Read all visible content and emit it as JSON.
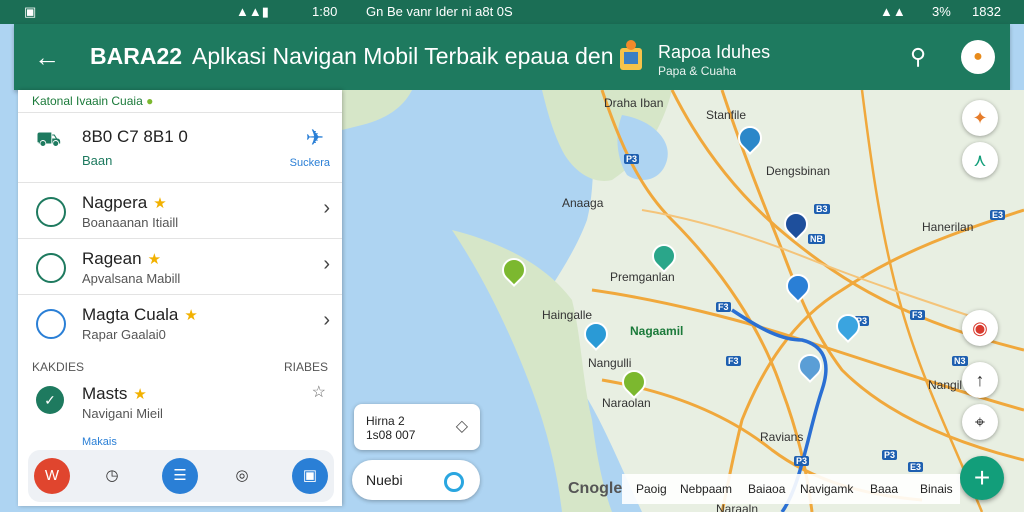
{
  "status": {
    "left_time": "1:80",
    "center_text": "Gn Be vanr Ider ni a8t 0S",
    "right_battery": "3%",
    "right_time": "1832"
  },
  "appbar": {
    "back_label": "←",
    "app_name": "BARA22",
    "title": "Aplkasi Navigan Mobil Terbaik epaua den",
    "weather_title": "Rapoa Iduhes",
    "weather_sub": "Papa & Cuaha",
    "search_label": "⚲",
    "avatar_label": "●"
  },
  "panel": {
    "header": "Katonal Ivaain Cuaia",
    "top": {
      "title": "8B0 C7 8B1 0",
      "sub": "Baan",
      "action": "Suckera"
    },
    "items": [
      {
        "title": "Nagpera",
        "sub": "Boanaanan Itiaill"
      },
      {
        "title": "Ragean",
        "sub": "Apvalsana Mabill"
      },
      {
        "title": "Magta Cuala",
        "sub": "Rapar Gaalai0"
      }
    ],
    "section_left": "KAKDIES",
    "section_right": "RIABES",
    "fav": {
      "title": "Masts",
      "sub": "Navigani Mieil"
    },
    "footer_label": "Makais"
  },
  "bottombar": {
    "b1": "W",
    "b2": "◷",
    "b3": "☰",
    "b4": "◎",
    "b5": "▣"
  },
  "map": {
    "labels": [
      "Draha Iban",
      "Stanfile",
      "Dengsbinan",
      "Anaaga",
      "Hanerilan",
      "Premganlan",
      "Haingalle",
      "Nagaamil",
      "Nangulli",
      "Naraolan",
      "Nangil",
      "Ravians",
      "Naraaln"
    ],
    "roads": [
      "P3",
      "E3",
      "NB",
      "F3",
      "P3",
      "F3",
      "F3",
      "N3",
      "P3",
      "P3",
      "E3",
      "B3"
    ],
    "card_top": {
      "line1": "Hirna 2",
      "line2": "1s08 007"
    },
    "card_bottom": {
      "label": "Nuebi"
    },
    "google": "Cnogle",
    "attrib": [
      "Paoig",
      "Nebpaam",
      "Baiaoa",
      "Navigamk",
      "Baaa",
      "Binais"
    ]
  },
  "colors": {
    "appbar": "#1e7a5f",
    "fab": "#129e7a",
    "road": "#f0a83c"
  }
}
